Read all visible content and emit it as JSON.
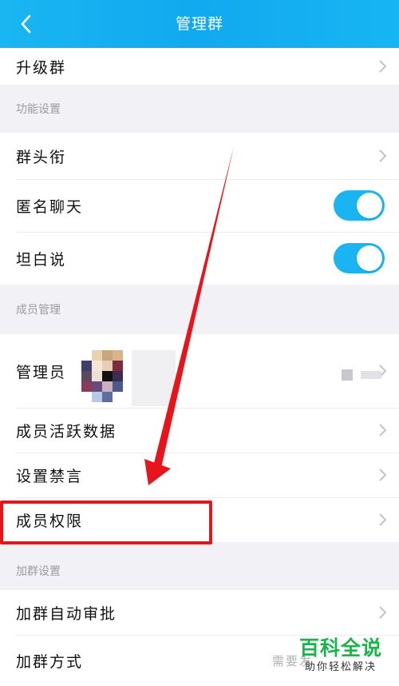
{
  "header": {
    "title": "管理群",
    "back_icon": "chevron-left-icon"
  },
  "top_group": {
    "items": [
      {
        "label": "升级群"
      }
    ]
  },
  "section_function": {
    "label": "功能设置",
    "items": [
      {
        "label": "群头衔",
        "control": "chevron"
      },
      {
        "label": "匿名聊天",
        "control": "toggle",
        "toggle_on": true
      },
      {
        "label": "坦白说",
        "control": "toggle",
        "toggle_on": true
      }
    ]
  },
  "section_members": {
    "label": "成员管理",
    "items": [
      {
        "label": "管理员",
        "control": "chevron"
      },
      {
        "label": "成员活跃数据",
        "control": "chevron"
      },
      {
        "label": "设置禁言",
        "control": "chevron"
      },
      {
        "label": "成员权限",
        "control": "chevron",
        "highlighted": true
      }
    ]
  },
  "section_join": {
    "label": "加群设置",
    "items": [
      {
        "label": "加群自动审批",
        "control": "chevron"
      },
      {
        "label": "加群方式",
        "hint": "需要发"
      }
    ]
  },
  "watermark": {
    "title": "百科全说",
    "subtitle": "助你轻松解决"
  },
  "colors": {
    "header_start": "#19b6f2",
    "toggle_on": "#1bb4f2",
    "annotation_red": "#e8141c",
    "watermark_green": "#1ab54a"
  }
}
